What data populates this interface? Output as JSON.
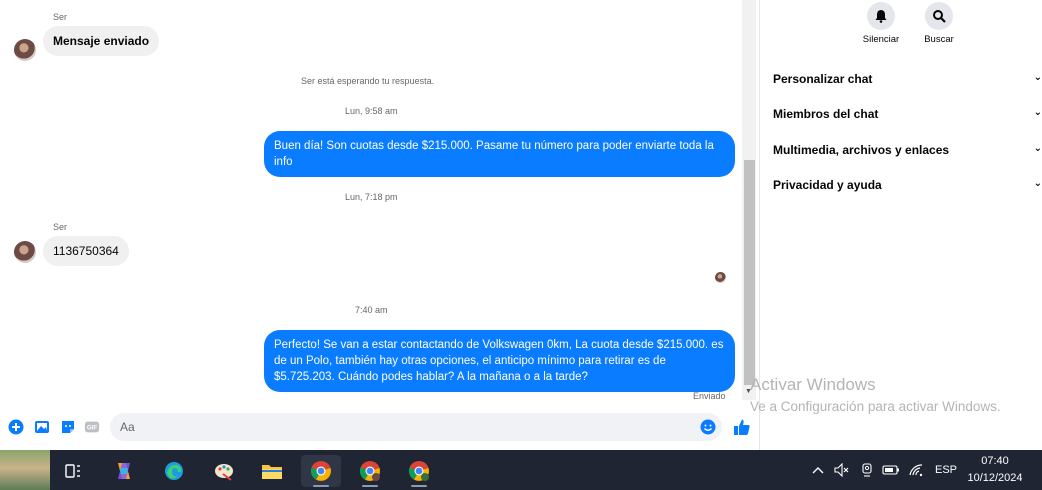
{
  "messages": {
    "group1_sender": "Ser",
    "msg1": "Mensaje enviado",
    "system_waiting": "Ser está esperando tu respuesta.",
    "time1": "Lun, 9:58 am",
    "out1": "Buen día! Son cuotas desde $215.000. Pasame tu número para poder enviarte toda la info",
    "time2": "Lun, 7:18 pm",
    "group2_sender": "Ser",
    "msg2": "1136750364",
    "time3": "7:40 am",
    "out2": "Perfecto!  Se van a estar contactando de Volkswagen 0km, La cuota desde $215.000. es de un Polo, también hay otras opciones, el anticipo mínimo para retirar es de $5.725.203. Cuándo podes hablar? A la mañana o a la tarde?",
    "status": "Enviado"
  },
  "composer": {
    "placeholder": "Aa",
    "icons": [
      "plus-circle-icon",
      "image-icon",
      "sticker-icon",
      "gif-icon",
      "emoji-icon",
      "thumbs-up-icon"
    ]
  },
  "panel": {
    "actions": [
      {
        "label": "Silenciar",
        "icon": "bell-icon"
      },
      {
        "label": "Buscar",
        "icon": "search-icon"
      }
    ],
    "menu": [
      {
        "label": "Personalizar chat"
      },
      {
        "label": "Miembros del chat"
      },
      {
        "label": "Multimedia, archivos y enlaces"
      },
      {
        "label": "Privacidad y ayuda"
      }
    ]
  },
  "watermark": {
    "title": "Activar Windows",
    "subtitle": "Ve a Configuración para activar Windows."
  },
  "taskbar": {
    "language": "ESP",
    "time": "07:40",
    "date": "10/12/2024"
  },
  "colors": {
    "accent": "#0a7cff",
    "bubble_in": "#f0f0f0",
    "taskbar": "#1f2532"
  }
}
